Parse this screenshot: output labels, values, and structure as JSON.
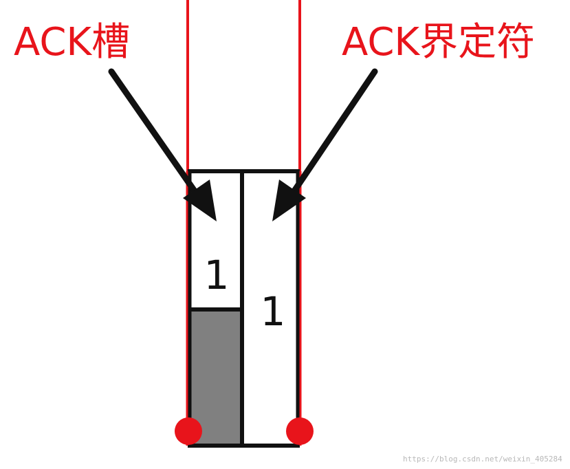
{
  "labels": {
    "ack_slot": "ACK槽",
    "ack_delimiter": "ACK界定符"
  },
  "bits": {
    "ack_slot_value": "1",
    "ack_delimiter_value": "1"
  },
  "watermark": "https://blog.csdn.net/weixin_405284",
  "colors": {
    "red_line": "#e8141b",
    "arrow": "#111111",
    "cell_border": "#111111",
    "dominant_fill": "#808080",
    "background": "#ffffff"
  }
}
